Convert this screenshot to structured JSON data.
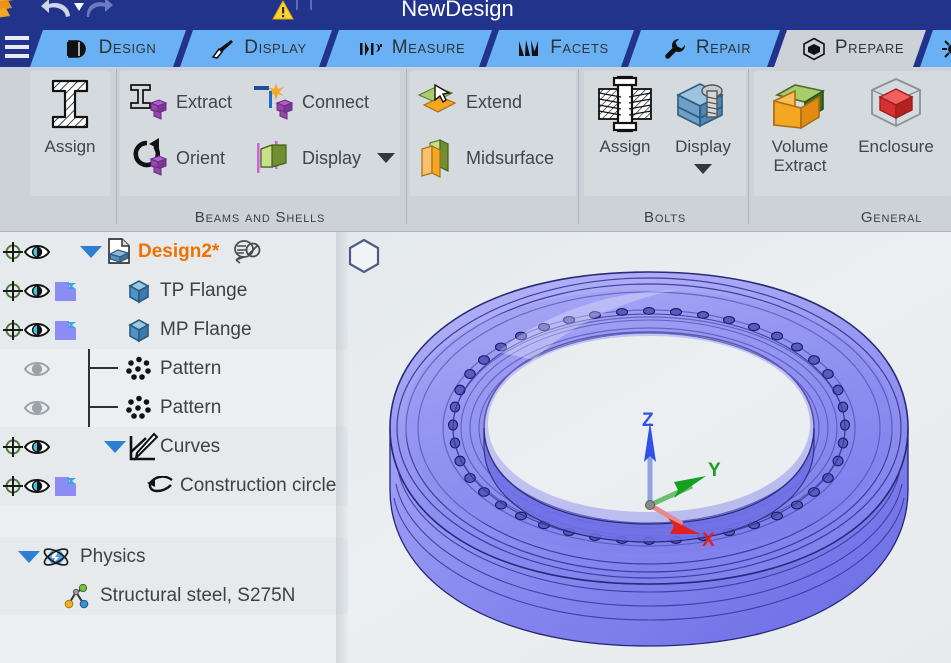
{
  "window": {
    "title": "NewDesign",
    "icons": {
      "logo": "app-logo-icon",
      "undo": "undo-icon",
      "undo_dropdown": "undo-dropdown-chevron-icon",
      "redo": "redo-icon",
      "warning": "warning-triangle-icon",
      "restore": "restore-window-icon"
    }
  },
  "menu": {
    "hamburger_label": "Menu"
  },
  "tabs": [
    {
      "label": "Design",
      "icon": "design-icon",
      "active": false
    },
    {
      "label": "Display",
      "icon": "brush-icon",
      "active": false
    },
    {
      "label": "Measure",
      "icon": "measure-icon",
      "active": false
    },
    {
      "label": "Facets",
      "icon": "facets-icon",
      "active": false
    },
    {
      "label": "Repair",
      "icon": "wrench-icon",
      "active": false
    },
    {
      "label": "Prepare",
      "icon": "cube-icon",
      "active": true
    },
    {
      "label": "",
      "icon": "workbench-icon",
      "active": false
    }
  ],
  "ribbon": {
    "groups": [
      {
        "title": "Beams and Shells",
        "big_buttons": [
          {
            "label": "Assign",
            "icon": "i-beam-icon"
          }
        ],
        "small_buttons": [
          {
            "label": "Extract",
            "icon": "beam-extract-icon",
            "has_caret": false
          },
          {
            "label": "Connect",
            "icon": "beam-connect-icon",
            "has_caret": false
          },
          {
            "label": "Orient",
            "icon": "beam-orient-icon",
            "has_caret": false
          },
          {
            "label": "Display",
            "icon": "beam-display-icon",
            "has_caret": true
          },
          {
            "label": "Extend",
            "icon": "extend-icon",
            "has_caret": false
          },
          {
            "label": "Midsurface",
            "icon": "midsurface-icon",
            "has_caret": false
          }
        ]
      },
      {
        "title": "Bolts",
        "big_buttons": [
          {
            "label": "Assign",
            "icon": "bolt-assign-icon",
            "has_caret": false
          },
          {
            "label": "Display",
            "icon": "bolt-display-icon",
            "has_caret": true
          }
        ],
        "small_buttons": []
      },
      {
        "title": "General",
        "big_buttons": [
          {
            "label": "Volume\nExtract",
            "icon": "volume-extract-icon"
          },
          {
            "label": "Enclosure",
            "icon": "enclosure-icon"
          }
        ],
        "small_buttons": []
      }
    ]
  },
  "tree": {
    "root": {
      "label": "Design2*",
      "icon": "design-document-icon",
      "badge_icon": "suppress-badge-icon",
      "expanded": true
    },
    "items": [
      {
        "label": "TP Flange",
        "icon": "solid-body-icon",
        "eye": "visible",
        "has_target": true,
        "has_swatch": true,
        "depth": 1
      },
      {
        "label": "MP Flange",
        "icon": "solid-body-icon",
        "eye": "visible",
        "has_target": true,
        "has_swatch": true,
        "depth": 1
      },
      {
        "label": "Pattern",
        "icon": "pattern-icon",
        "eye": "hidden",
        "has_target": false,
        "has_swatch": false,
        "depth": 1
      },
      {
        "label": "Pattern",
        "icon": "pattern-icon",
        "eye": "hidden",
        "has_target": false,
        "has_swatch": false,
        "depth": 1
      },
      {
        "label": "Curves",
        "icon": "curves-icon",
        "eye": "visible",
        "has_target": true,
        "has_swatch": false,
        "depth": 1,
        "expanded": true
      },
      {
        "label": "Construction circle",
        "icon": "construction-curve-icon",
        "eye": "visible",
        "has_target": true,
        "has_swatch": true,
        "depth": 2
      }
    ],
    "physics": {
      "label": "Physics",
      "icon": "physics-atom-icon",
      "expanded": true,
      "children": [
        {
          "label": "Structural steel, S275N",
          "icon": "material-icon"
        }
      ]
    }
  },
  "viewport": {
    "hex_icon": "hexagon-icon",
    "model_name": "bolted-flange-ring",
    "triad": {
      "x_label": "X",
      "x_color": "#e02020",
      "y_label": "Y",
      "y_color": "#16a020",
      "z_label": "Z",
      "z_color": "#3050e8"
    }
  },
  "colors": {
    "title_bar": "#22338c",
    "tab_inactive": "#6ab0f5",
    "tab_active": "#ccd2d8",
    "ribbon_bg": "#ccd2d8",
    "panel_bg": "#d5dade",
    "tree_bg": "#eceff1",
    "accent_orange": "#f07000",
    "model_body": "#8c8cf0"
  }
}
